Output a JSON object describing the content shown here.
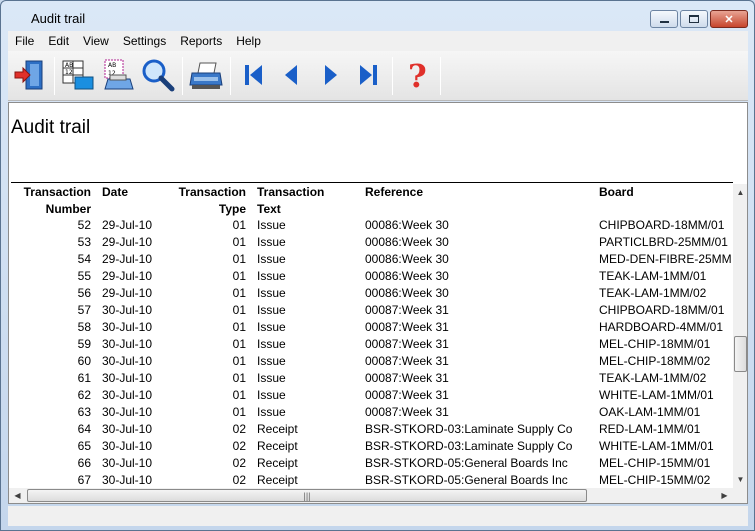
{
  "window": {
    "title": "Audit trail"
  },
  "menu": [
    "File",
    "Edit",
    "View",
    "Settings",
    "Reports",
    "Help"
  ],
  "toolbar": {
    "icons": [
      "exit-icon",
      "report-layout-icon",
      "print-setup-icon",
      "search-icon",
      "print-icon",
      "first-record-icon",
      "previous-record-icon",
      "next-record-icon",
      "last-record-icon",
      "help-icon"
    ]
  },
  "report": {
    "title": "Audit trail",
    "headers": {
      "number": [
        "Transaction",
        "Number"
      ],
      "date": "Date",
      "type": [
        "Transaction",
        "Type"
      ],
      "text": [
        "Transaction",
        "Text"
      ],
      "reference": "Reference",
      "board": "Board"
    },
    "rows": [
      [
        "52",
        "29-Jul-10",
        "01",
        "Issue",
        "00086:Week 30",
        "CHIPBOARD-18MM/01"
      ],
      [
        "53",
        "29-Jul-10",
        "01",
        "Issue",
        "00086:Week 30",
        "PARTICLBRD-25MM/01"
      ],
      [
        "54",
        "29-Jul-10",
        "01",
        "Issue",
        "00086:Week 30",
        "MED-DEN-FIBRE-25MM"
      ],
      [
        "55",
        "29-Jul-10",
        "01",
        "Issue",
        "00086:Week 30",
        "TEAK-LAM-1MM/01"
      ],
      [
        "56",
        "29-Jul-10",
        "01",
        "Issue",
        "00086:Week 30",
        "TEAK-LAM-1MM/02"
      ],
      [
        "57",
        "30-Jul-10",
        "01",
        "Issue",
        "00087:Week 31",
        "CHIPBOARD-18MM/01"
      ],
      [
        "58",
        "30-Jul-10",
        "01",
        "Issue",
        "00087:Week 31",
        "HARDBOARD-4MM/01"
      ],
      [
        "59",
        "30-Jul-10",
        "01",
        "Issue",
        "00087:Week 31",
        "MEL-CHIP-18MM/01"
      ],
      [
        "60",
        "30-Jul-10",
        "01",
        "Issue",
        "00087:Week 31",
        "MEL-CHIP-18MM/02"
      ],
      [
        "61",
        "30-Jul-10",
        "01",
        "Issue",
        "00087:Week 31",
        "TEAK-LAM-1MM/02"
      ],
      [
        "62",
        "30-Jul-10",
        "01",
        "Issue",
        "00087:Week 31",
        "WHITE-LAM-1MM/01"
      ],
      [
        "63",
        "30-Jul-10",
        "01",
        "Issue",
        "00087:Week 31",
        "OAK-LAM-1MM/01"
      ],
      [
        "64",
        "30-Jul-10",
        "02",
        "Receipt",
        "BSR-STKORD-03:Laminate Supply Co",
        "RED-LAM-1MM/01"
      ],
      [
        "65",
        "30-Jul-10",
        "02",
        "Receipt",
        "BSR-STKORD-03:Laminate Supply Co",
        "WHITE-LAM-1MM/01"
      ],
      [
        "66",
        "30-Jul-10",
        "02",
        "Receipt",
        "BSR-STKORD-05:General Boards Inc",
        "MEL-CHIP-15MM/01"
      ],
      [
        "67",
        "30-Jul-10",
        "02",
        "Receipt",
        "BSR-STKORD-05:General Boards Inc",
        "MEL-CHIP-15MM/02"
      ]
    ]
  },
  "scrollbars": {
    "vertical_position": 0.45,
    "horizontal_position": 0.0
  },
  "colors": {
    "frame": "#c4d6ec",
    "accent_blue": "#1a5fc8",
    "help_red": "#e0302a"
  }
}
